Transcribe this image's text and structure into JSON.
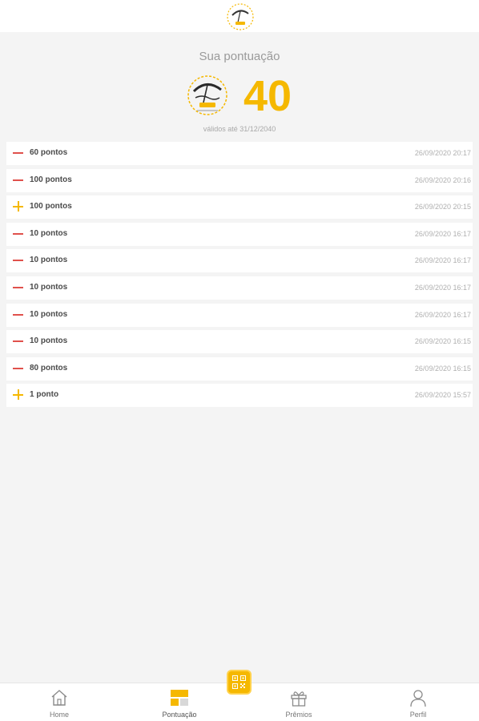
{
  "header": {
    "logo_icon": "beach-umbrella-logo-icon"
  },
  "score": {
    "title": "Sua pontuação",
    "value": "40",
    "validity": "válidos até 31/12/2040",
    "accent_color": "#f5b800"
  },
  "transactions": [
    {
      "type": "minus",
      "amount": "60 pontos",
      "date": "26/09/2020 20:17"
    },
    {
      "type": "minus",
      "amount": "100 pontos",
      "date": "26/09/2020 20:16"
    },
    {
      "type": "plus",
      "amount": "100 pontos",
      "date": "26/09/2020 20:15"
    },
    {
      "type": "minus",
      "amount": "10 pontos",
      "date": "26/09/2020 16:17"
    },
    {
      "type": "minus",
      "amount": "10 pontos",
      "date": "26/09/2020 16:17"
    },
    {
      "type": "minus",
      "amount": "10 pontos",
      "date": "26/09/2020 16:17"
    },
    {
      "type": "minus",
      "amount": "10 pontos",
      "date": "26/09/2020 16:17"
    },
    {
      "type": "minus",
      "amount": "10 pontos",
      "date": "26/09/2020 16:15"
    },
    {
      "type": "minus",
      "amount": "80 pontos",
      "date": "26/09/2020 16:15"
    },
    {
      "type": "plus",
      "amount": "1 ponto",
      "date": "26/09/2020 15:57"
    }
  ],
  "nav": {
    "home": "Home",
    "points": "Pontuação",
    "rewards": "Prêmios",
    "profile": "Perfil",
    "active": "points"
  },
  "colors": {
    "minus": "#e0514c",
    "plus": "#f5b800"
  }
}
